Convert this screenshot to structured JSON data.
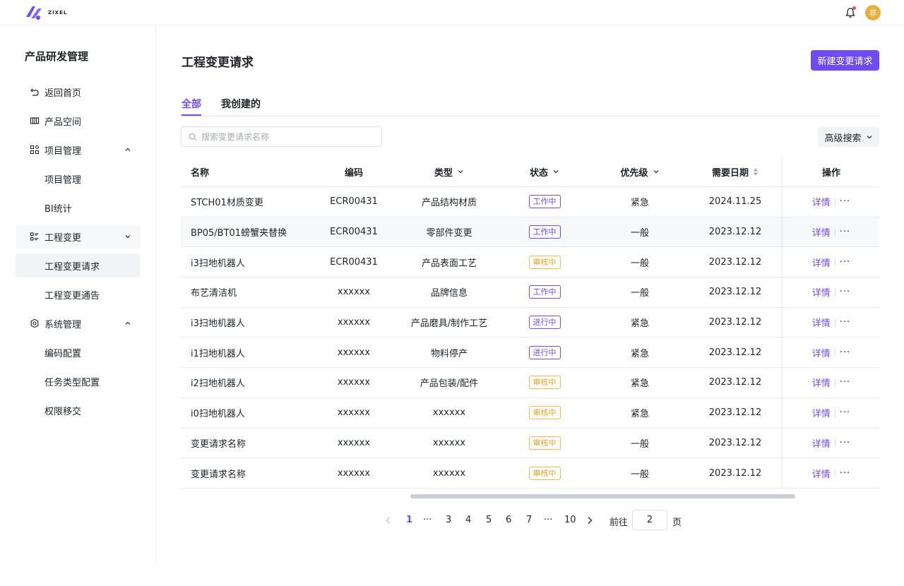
{
  "app": {
    "logo_text": "ZIXEL",
    "avatar_text": "非"
  },
  "sidebar": {
    "title": "产品研发管理",
    "items": [
      {
        "label": "返回首页",
        "icon": "back-icon"
      },
      {
        "label": "产品空间",
        "icon": "product-space-icon"
      },
      {
        "label": "项目管理",
        "icon": "project-icon"
      },
      {
        "label": "项目管理"
      },
      {
        "label": "BI统计"
      },
      {
        "label": "工程变更",
        "icon": "change-icon"
      },
      {
        "label": "工程变更请求"
      },
      {
        "label": "工程变更通告"
      },
      {
        "label": "系统管理",
        "icon": "gear-icon"
      },
      {
        "label": "编码配置"
      },
      {
        "label": "任务类型配置"
      },
      {
        "label": "权限移交"
      }
    ]
  },
  "main": {
    "title": "工程变更请求",
    "new_button": "新建变更请求",
    "tabs": [
      {
        "label": "全部"
      },
      {
        "label": "我创建的"
      }
    ],
    "search": {
      "placeholder": "搜索变更请求名称"
    },
    "advanced_search": "高级搜索"
  },
  "table": {
    "columns": {
      "name": "名称",
      "code": "编码",
      "type": "类型",
      "status": "状态",
      "priority": "优先级",
      "date": "需要日期",
      "actions": "操作"
    },
    "rows": [
      {
        "name": "STCH01材质变更",
        "code": "ECR00431",
        "type": "产品结构材质",
        "status": "工作中",
        "priority": "紧急",
        "date": "2024.11.25",
        "detail": "详情",
        "more": "···"
      },
      {
        "name": "BP05/BT01螃蟹夹替换",
        "code": "ECR00431",
        "type": "零部件变更",
        "status": "工作中",
        "priority": "一般",
        "date": "2023.12.12",
        "detail": "详情",
        "more": "···"
      },
      {
        "name": "i3扫地机器人",
        "code": "ECR00431",
        "type": "产品表面工艺",
        "status": "审核中",
        "priority": "一般",
        "date": "2023.12.12",
        "detail": "详情",
        "more": "···"
      },
      {
        "name": "布艺清洁机",
        "code": "xxxxxx",
        "type": "品牌信息",
        "status": "工作中",
        "priority": "一般",
        "date": "2023.12.12",
        "detail": "详情",
        "more": "···"
      },
      {
        "name": "i3扫地机器人",
        "code": "xxxxxx",
        "type": "产品磨具/制作工艺",
        "status": "进行中",
        "priority": "紧急",
        "date": "2023.12.12",
        "detail": "详情",
        "more": "···"
      },
      {
        "name": "i1扫地机器人",
        "code": "xxxxxx",
        "type": "物料停产",
        "status": "进行中",
        "priority": "紧急",
        "date": "2023.12.12",
        "detail": "详情",
        "more": "···"
      },
      {
        "name": "i2扫地机器人",
        "code": "xxxxxx",
        "type": "产品包装/配件",
        "status": "审核中",
        "priority": "紧急",
        "date": "2023.12.12",
        "detail": "详情",
        "more": "···"
      },
      {
        "name": "i0扫地机器人",
        "code": "xxxxxx",
        "type": "xxxxxx",
        "status": "审核中",
        "priority": "紧急",
        "date": "2023.12.12",
        "detail": "详情",
        "more": "···"
      },
      {
        "name": "变更请求名称",
        "code": "xxxxxx",
        "type": "xxxxxx",
        "status": "审核中",
        "priority": "一般",
        "date": "2023.12.12",
        "detail": "详情",
        "more": "···"
      },
      {
        "name": "变更请求名称",
        "code": "xxxxxx",
        "type": "xxxxxx",
        "status": "审核中",
        "priority": "一般",
        "date": "2023.12.12",
        "detail": "详情",
        "more": "···"
      }
    ]
  },
  "pagination": {
    "pages": [
      "1",
      "···",
      "3",
      "4",
      "5",
      "6",
      "7",
      "···",
      "10"
    ],
    "current": "1",
    "goto_label": "前往",
    "goto_value": "2",
    "page_suffix": "页"
  },
  "colors": {
    "accent": "#6e4bf2",
    "review": "#f0a020",
    "avatar": "#e8b23a"
  }
}
